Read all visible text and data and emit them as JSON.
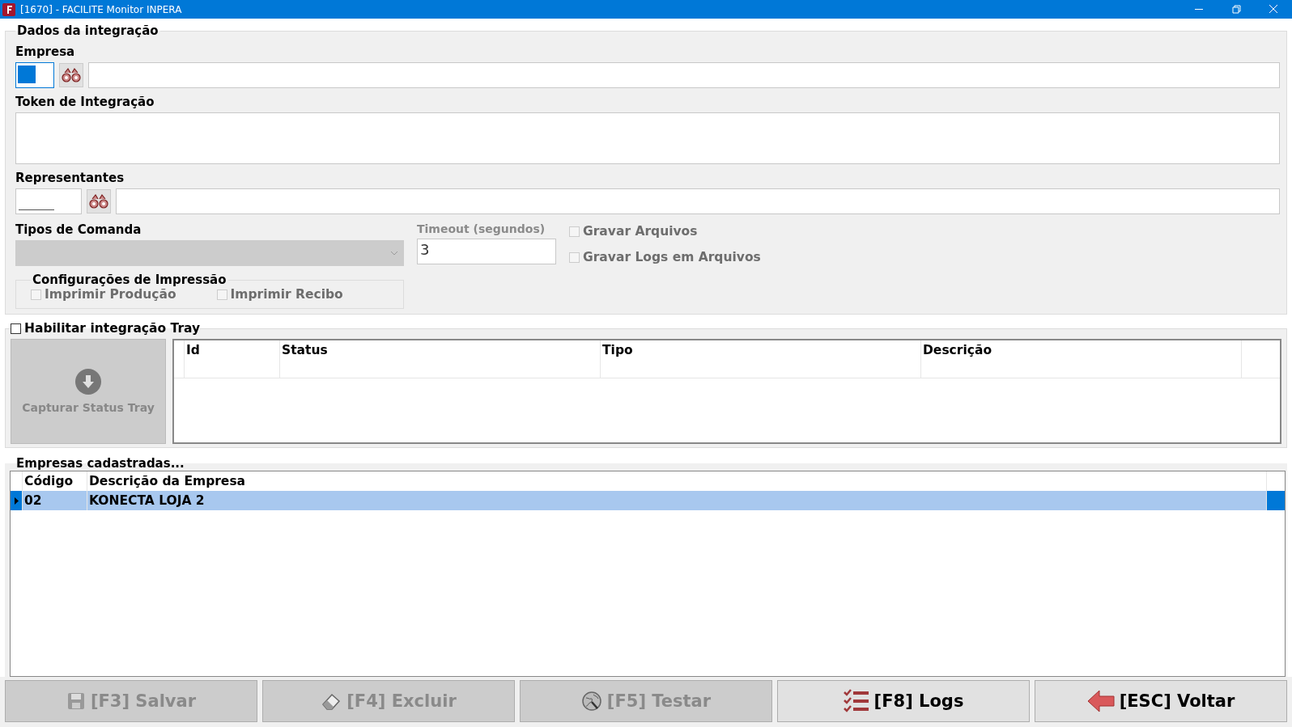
{
  "window": {
    "title": "[1670] - FACILITE Monitor INPERA"
  },
  "integration": {
    "title": "Dados da integração",
    "empresa_label": "Empresa",
    "token_label": "Token de Integração",
    "representantes_label": "Representantes",
    "tipos_label": "Tipos de Comanda",
    "tipos_disabled": true,
    "timeout": {
      "label": "Timeout (segundos)",
      "disabled": true,
      "value": "3"
    },
    "options": [
      {
        "label": "Gravar Arquivos",
        "checked": false,
        "disabled": true
      },
      {
        "label": "Gravar Logs em Arquivos",
        "checked": false,
        "disabled": true
      }
    ],
    "print_config": {
      "title": "Configurações de Impressão",
      "options": [
        {
          "label": "Imprimir Produção",
          "checked": false,
          "disabled": true
        },
        {
          "label": "Imprimir Recibo",
          "checked": false,
          "disabled": true
        }
      ]
    }
  },
  "tray": {
    "enable": {
      "label": "Habilitar integração Tray",
      "checked": false
    },
    "capture_button": {
      "label": "Capturar Status Tray",
      "disabled": true
    },
    "columns": [
      "Id",
      "Status",
      "Tipo",
      "Descrição"
    ]
  },
  "companies": {
    "title": "Empresas cadastradas...",
    "columns": [
      "Código",
      "Descrição da Empresa"
    ],
    "rows": [
      {
        "cells": [
          "02",
          "KONECTA LOJA 2"
        ],
        "selected": true
      }
    ]
  },
  "buttons": [
    {
      "kind": "save",
      "label": "[F3] Salvar",
      "disabled": true
    },
    {
      "kind": "delete",
      "label": "[F4] Excluir",
      "disabled": true
    },
    {
      "kind": "test",
      "label": "[F5] Testar",
      "disabled": true
    },
    {
      "kind": "logs",
      "label": "[F8] Logs",
      "disabled": false
    },
    {
      "kind": "back",
      "label": "[ESC] Voltar",
      "disabled": false
    }
  ]
}
